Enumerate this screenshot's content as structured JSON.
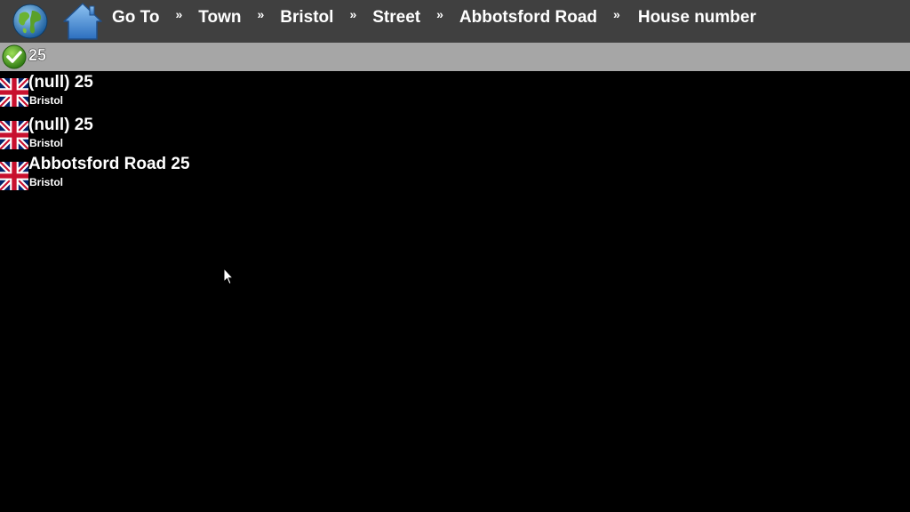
{
  "header": {
    "globe_icon": "globe-icon",
    "home_icon": "home-icon",
    "breadcrumbs": [
      "Go To",
      "Town",
      "Bristol",
      "Street",
      "Abbotsford Road",
      "House number"
    ],
    "separator": "»",
    "bar_color": "#404040"
  },
  "input": {
    "value": "25",
    "confirm_icon": "checkmark-icon",
    "row_color": "#a6a6a6"
  },
  "results": [
    {
      "title": "(null) 25",
      "subtitle": "Bristol",
      "icon": "uk-flag-icon"
    },
    {
      "title": "(null) 25",
      "subtitle": "Bristol",
      "icon": "uk-flag-icon"
    },
    {
      "title": "Abbotsford Road 25",
      "subtitle": "Bristol",
      "icon": "uk-flag-icon"
    }
  ]
}
